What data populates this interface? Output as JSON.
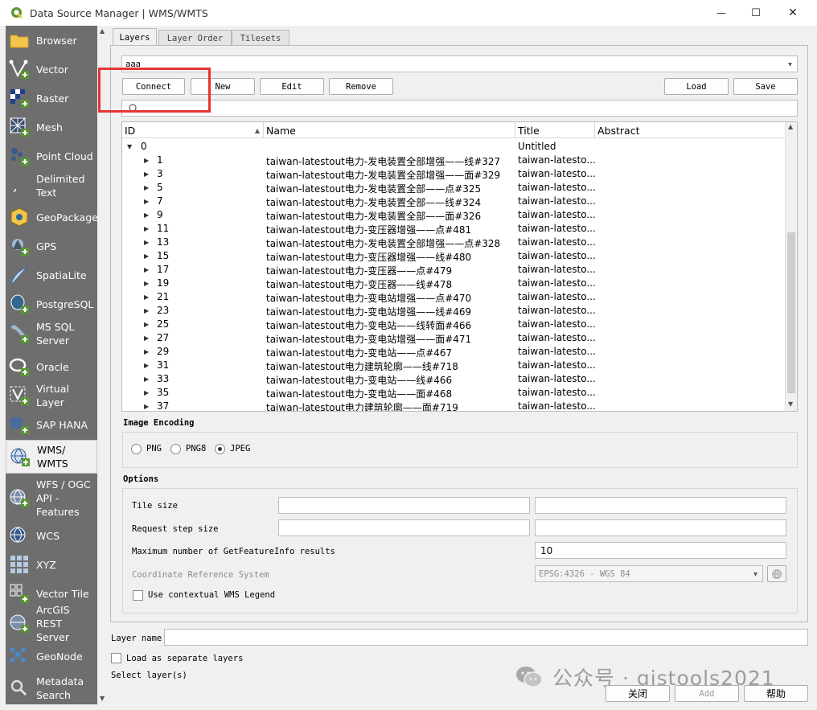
{
  "window": {
    "title": "Data Source Manager | WMS/WMTS",
    "minimize": "—",
    "maximize": "☐",
    "close": "✕"
  },
  "sidebar": {
    "items": [
      {
        "label": "Browser",
        "icon": "folder-icon"
      },
      {
        "label": "Vector",
        "icon": "vector-icon"
      },
      {
        "label": "Raster",
        "icon": "raster-icon"
      },
      {
        "label": "Mesh",
        "icon": "mesh-icon"
      },
      {
        "label": "Point Cloud",
        "icon": "point-cloud-icon"
      },
      {
        "label": "Delimited Text",
        "icon": "delimited-text-icon"
      },
      {
        "label": "GeoPackage",
        "icon": "geopackage-icon"
      },
      {
        "label": "GPS",
        "icon": "gps-icon"
      },
      {
        "label": "SpatiaLite",
        "icon": "spatialite-icon"
      },
      {
        "label": "PostgreSQL",
        "icon": "postgresql-icon"
      },
      {
        "label": "MS SQL Server",
        "icon": "mssql-icon"
      },
      {
        "label": "Oracle",
        "icon": "oracle-icon"
      },
      {
        "label": "Virtual Layer",
        "icon": "virtual-layer-icon"
      },
      {
        "label": "SAP HANA",
        "icon": "sap-hana-icon"
      },
      {
        "label": "WMS/ WMTS",
        "icon": "wms-icon",
        "selected": true
      },
      {
        "label": "WFS / OGC API - Features",
        "icon": "wfs-icon"
      },
      {
        "label": "WCS",
        "icon": "wcs-icon"
      },
      {
        "label": "XYZ",
        "icon": "xyz-icon"
      },
      {
        "label": "Vector Tile",
        "icon": "vector-tile-icon"
      },
      {
        "label": "ArcGIS REST Server",
        "icon": "arcgis-icon"
      },
      {
        "label": "GeoNode",
        "icon": "geonode-icon"
      },
      {
        "label": "Metadata Search",
        "icon": "metadata-search-icon"
      }
    ]
  },
  "tabs": [
    {
      "label": "Layers",
      "active": true
    },
    {
      "label": "Layer Order"
    },
    {
      "label": "Tilesets"
    }
  ],
  "connection": {
    "selected": "aaa",
    "buttons": {
      "connect": "Connect",
      "new": "New",
      "edit": "Edit",
      "remove": "Remove",
      "load": "Load",
      "save": "Save"
    }
  },
  "table": {
    "columns": [
      "ID",
      "Name",
      "Title",
      "Abstract"
    ],
    "root": {
      "id": "0",
      "title": "Untitled"
    },
    "rows": [
      {
        "id": "1",
        "name": "taiwan-latestout电力-发电装置全部增强——线#327",
        "title": "taiwan-latesto..."
      },
      {
        "id": "3",
        "name": "taiwan-latestout电力-发电装置全部增强——面#329",
        "title": "taiwan-latesto..."
      },
      {
        "id": "5",
        "name": "taiwan-latestout电力-发电装置全部——点#325",
        "title": "taiwan-latesto..."
      },
      {
        "id": "7",
        "name": "taiwan-latestout电力-发电装置全部——线#324",
        "title": "taiwan-latesto..."
      },
      {
        "id": "9",
        "name": "taiwan-latestout电力-发电装置全部——面#326",
        "title": "taiwan-latesto..."
      },
      {
        "id": "11",
        "name": "taiwan-latestout电力-变压器增强——点#481",
        "title": "taiwan-latesto..."
      },
      {
        "id": "13",
        "name": "taiwan-latestout电力-发电装置全部增强——点#328",
        "title": "taiwan-latesto..."
      },
      {
        "id": "15",
        "name": "taiwan-latestout电力-变压器增强——线#480",
        "title": "taiwan-latesto..."
      },
      {
        "id": "17",
        "name": "taiwan-latestout电力-变压器——点#479",
        "title": "taiwan-latesto..."
      },
      {
        "id": "19",
        "name": "taiwan-latestout电力-变压器——线#478",
        "title": "taiwan-latesto..."
      },
      {
        "id": "21",
        "name": "taiwan-latestout电力-变电站增强——点#470",
        "title": "taiwan-latesto..."
      },
      {
        "id": "23",
        "name": "taiwan-latestout电力-变电站增强——线#469",
        "title": "taiwan-latesto..."
      },
      {
        "id": "25",
        "name": "taiwan-latestout电力-变电站——线转面#466",
        "title": "taiwan-latesto..."
      },
      {
        "id": "27",
        "name": "taiwan-latestout电力-变电站增强——面#471",
        "title": "taiwan-latesto..."
      },
      {
        "id": "29",
        "name": "taiwan-latestout电力-变电站——点#467",
        "title": "taiwan-latesto..."
      },
      {
        "id": "31",
        "name": "taiwan-latestout电力建筑轮廓——线#718",
        "title": "taiwan-latesto..."
      },
      {
        "id": "33",
        "name": "taiwan-latestout电力-变电站——线#466",
        "title": "taiwan-latesto..."
      },
      {
        "id": "35",
        "name": "taiwan-latestout电力-变电站——面#468",
        "title": "taiwan-latesto..."
      },
      {
        "id": "37",
        "name": "taiwan-latestout电力建筑轮廓——面#719",
        "title": "taiwan-latesto..."
      }
    ]
  },
  "image_encoding": {
    "title": "Image Encoding",
    "options": [
      "PNG",
      "PNG8",
      "JPEG"
    ],
    "selected": "JPEG"
  },
  "options": {
    "title": "Options",
    "tile_size_label": "Tile size",
    "request_step_label": "Request step size",
    "max_featureinfo_label": "Maximum number of GetFeatureInfo results",
    "max_featureinfo_value": "10",
    "crs_label": "Coordinate Reference System",
    "crs_value": "EPSG:4326 - WGS 84",
    "contextual_legend_label": "Use contextual WMS Legend"
  },
  "bottom": {
    "layer_name_label": "Layer name",
    "layer_name_value": "",
    "load_separate_label": "Load as separate layers",
    "status": "Select layer(s)",
    "close_button": "关闭",
    "add_button": "Add",
    "help_button": "帮助"
  },
  "watermark": "公众号 · gistools2021",
  "colors": {
    "sidebar_bg": "#6e6e6e",
    "highlight": "#e83333",
    "qgis_green": "#589632"
  }
}
